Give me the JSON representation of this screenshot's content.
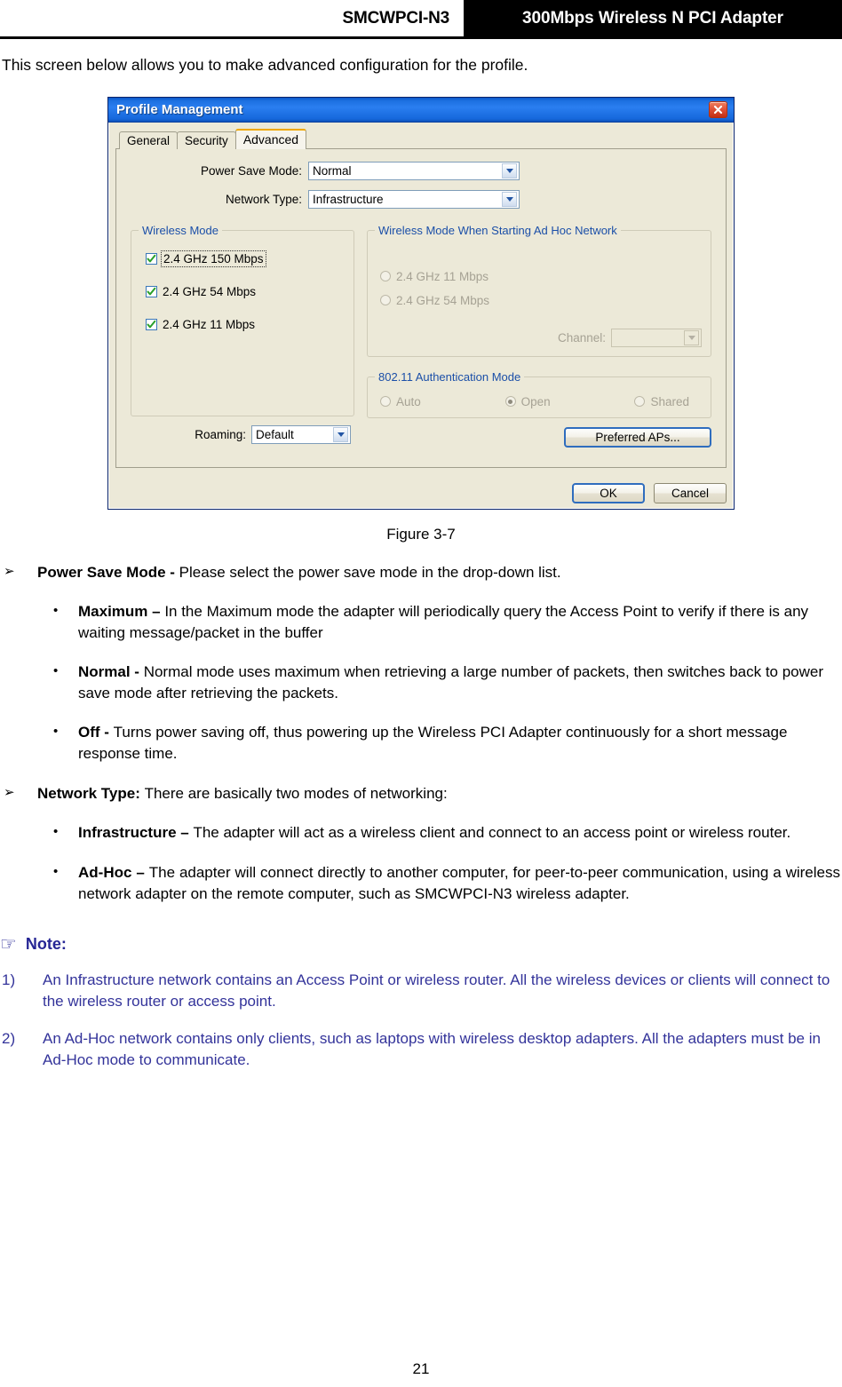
{
  "header": {
    "product_code": "SMCWPCI-N3",
    "product_name": "300Mbps Wireless N PCI Adapter"
  },
  "intro": "This screen below allows you to make advanced configuration for the profile.",
  "dialog": {
    "title": "Profile Management",
    "close_icon": "close-icon",
    "tabs": [
      {
        "label": "General",
        "active": false
      },
      {
        "label": "Security",
        "active": false
      },
      {
        "label": "Advanced",
        "active": true
      }
    ],
    "fields": {
      "power_save_mode_label": "Power Save Mode:",
      "power_save_mode_value": "Normal",
      "network_type_label": "Network Type:",
      "network_type_value": "Infrastructure"
    },
    "wireless_mode": {
      "legend": "Wireless Mode",
      "items": [
        {
          "label": "2.4 GHz 150 Mbps",
          "checked": true,
          "focused": true
        },
        {
          "label": "2.4 GHz 54 Mbps",
          "checked": true,
          "focused": false
        },
        {
          "label": "2.4 GHz 11 Mbps",
          "checked": true,
          "focused": false
        }
      ],
      "roaming_label": "Roaming:",
      "roaming_value": "Default"
    },
    "adhoc_mode": {
      "legend": "Wireless Mode When Starting Ad Hoc Network",
      "items": [
        {
          "label": "2.4 GHz 11 Mbps",
          "selected": false
        },
        {
          "label": "2.4 GHz 54 Mbps",
          "selected": false
        }
      ],
      "channel_label": "Channel:",
      "channel_value": ""
    },
    "auth_mode": {
      "legend": "802.11 Authentication Mode",
      "items": [
        {
          "label": "Auto",
          "selected": false
        },
        {
          "label": "Open",
          "selected": true
        },
        {
          "label": "Shared",
          "selected": false
        }
      ]
    },
    "preferred_aps_label": "Preferred APs...",
    "ok_label": "OK",
    "cancel_label": "Cancel"
  },
  "figure_caption": "Figure 3-7",
  "sections": [
    {
      "marker": "➢",
      "term": "Power Save Mode - ",
      "body": "Please select the power save mode in the drop-down list.",
      "subitems": [
        {
          "marker": "•",
          "term": "Maximum – ",
          "body": "In the Maximum mode the adapter will periodically query the Access Point to verify if there is any waiting message/packet in the buffer",
          "justify": false
        },
        {
          "marker": "•",
          "term": "Normal - ",
          "body": "Normal mode uses maximum when retrieving a large number of packets, then switches back to power save mode after retrieving the packets.",
          "justify": false
        },
        {
          "marker": "•",
          "term": "Off - ",
          "body": "Turns power saving off, thus powering up the Wireless PCI Adapter continuously for a short message response time.",
          "justify": false
        }
      ]
    },
    {
      "marker": "➢",
      "term": "Network Type: ",
      "body": "There are basically two modes of networking:",
      "subitems": [
        {
          "marker": "•",
          "term": "Infrastructure – ",
          "body": "The adapter will act as a wireless client and connect to an access point or wireless router.",
          "justify": false
        },
        {
          "marker": "•",
          "term": "Ad-Hoc – ",
          "body": "The adapter will connect directly to another computer, for peer-to-peer communication, using a wireless network adapter on the remote computer, such as SMCWPCI-N3 wireless adapter.",
          "justify": true
        }
      ]
    }
  ],
  "note": {
    "hand_icon": "☞",
    "title": "Note:",
    "items": [
      {
        "num": "1)",
        "text": "An Infrastructure network contains an Access Point or wireless router. All the wireless devices or clients will connect to the wireless router or access point."
      },
      {
        "num": "2)",
        "text": "An Ad-Hoc network contains only clients, such as laptops with wireless desktop adapters. All the adapters must be in Ad-Hoc mode to communicate."
      }
    ]
  },
  "page_number": "21",
  "colors": {
    "note_text": "#33339a",
    "group_legend": "#1b4fa8",
    "titlebar": "#1c6fe0",
    "active_tab_accent": "#f0a800"
  }
}
